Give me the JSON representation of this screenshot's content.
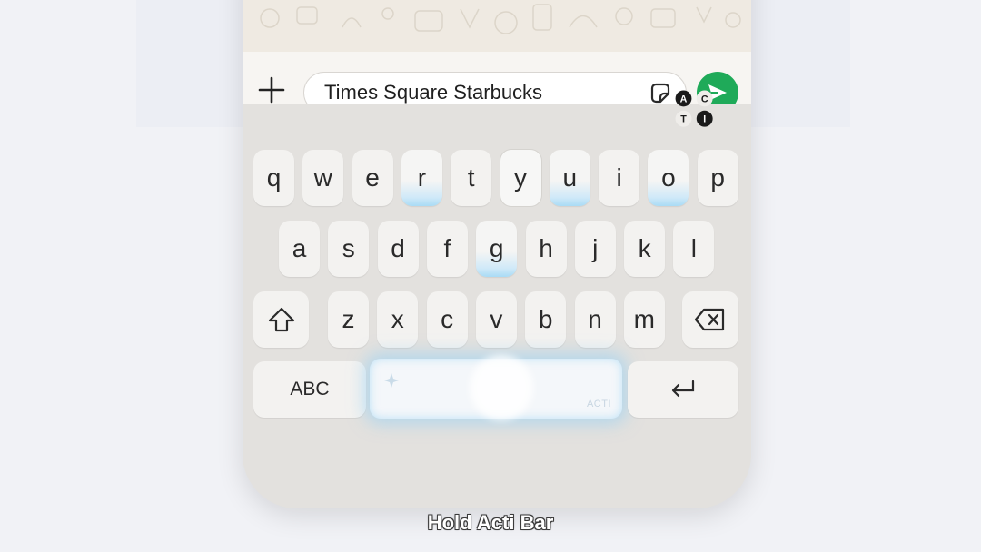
{
  "input": {
    "value": "Times Square Starbucks",
    "plus_icon": "plus-icon",
    "sticker_icon": "sticker-icon",
    "send_icon": "send-icon",
    "send_color": "#1faa59"
  },
  "acti_logo": {
    "letters": [
      "A",
      "C",
      "T",
      "I"
    ]
  },
  "keyboard": {
    "row1": [
      "q",
      "w",
      "e",
      "r",
      "t",
      "y",
      "u",
      "i",
      "o",
      "p"
    ],
    "row2": [
      "a",
      "s",
      "d",
      "f",
      "g",
      "h",
      "j",
      "k",
      "l"
    ],
    "row3": [
      "z",
      "x",
      "c",
      "v",
      "b",
      "n",
      "m"
    ],
    "abc_label": "ABC",
    "space_label": "ACTI",
    "glowing_keys": [
      "r",
      "u",
      "o",
      "g"
    ],
    "highlight_color": "#a9dbf5"
  },
  "caption": "Hold Acti Bar"
}
